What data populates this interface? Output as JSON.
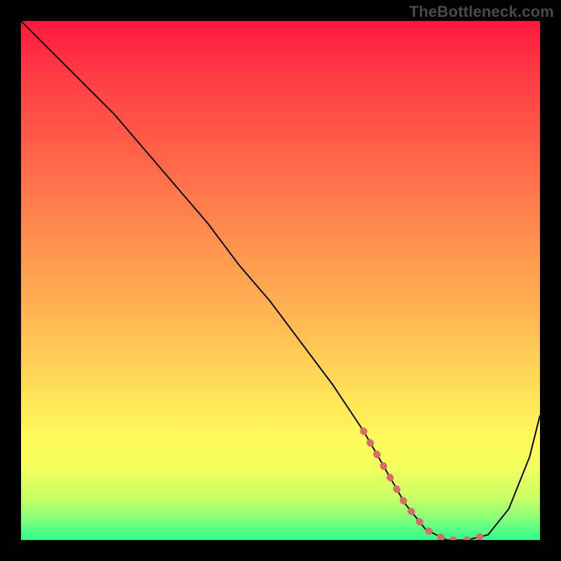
{
  "watermark": "TheBottleneck.com",
  "chart_data": {
    "type": "line",
    "title": "",
    "xlabel": "",
    "ylabel": "",
    "xlim": [
      0,
      100
    ],
    "ylim": [
      0,
      100
    ],
    "series": [
      {
        "name": "bottleneck-curve",
        "x": [
          0,
          6,
          12,
          18,
          24,
          30,
          36,
          42,
          48,
          54,
          60,
          66,
          70,
          74,
          78,
          82,
          86,
          90,
          94,
          98,
          100
        ],
        "values": [
          100,
          94,
          88,
          82,
          75,
          68,
          61,
          53,
          46,
          38,
          30,
          21,
          14,
          7,
          2,
          0,
          0,
          1,
          6,
          16,
          24
        ]
      }
    ],
    "optimal_band": {
      "name": "optimal-segment",
      "x": [
        66,
        70,
        74,
        78,
        82,
        86,
        90
      ],
      "values": [
        21,
        14,
        7,
        2,
        0,
        0,
        1
      ]
    },
    "gradient_stops": [
      {
        "pos": 0,
        "color": "#ff173f"
      },
      {
        "pos": 10,
        "color": "#ff3b44"
      },
      {
        "pos": 25,
        "color": "#ff6149"
      },
      {
        "pos": 40,
        "color": "#ff8a4e"
      },
      {
        "pos": 55,
        "color": "#ffb152"
      },
      {
        "pos": 68,
        "color": "#ffd656"
      },
      {
        "pos": 80,
        "color": "#fff95a"
      },
      {
        "pos": 86,
        "color": "#f3ff5d"
      },
      {
        "pos": 92,
        "color": "#c8ff66"
      },
      {
        "pos": 96,
        "color": "#82ff7a"
      },
      {
        "pos": 100,
        "color": "#2bff8e"
      }
    ],
    "colors": {
      "curve": "#000000",
      "optimal": "#d96b6b",
      "background": "#000000"
    }
  }
}
